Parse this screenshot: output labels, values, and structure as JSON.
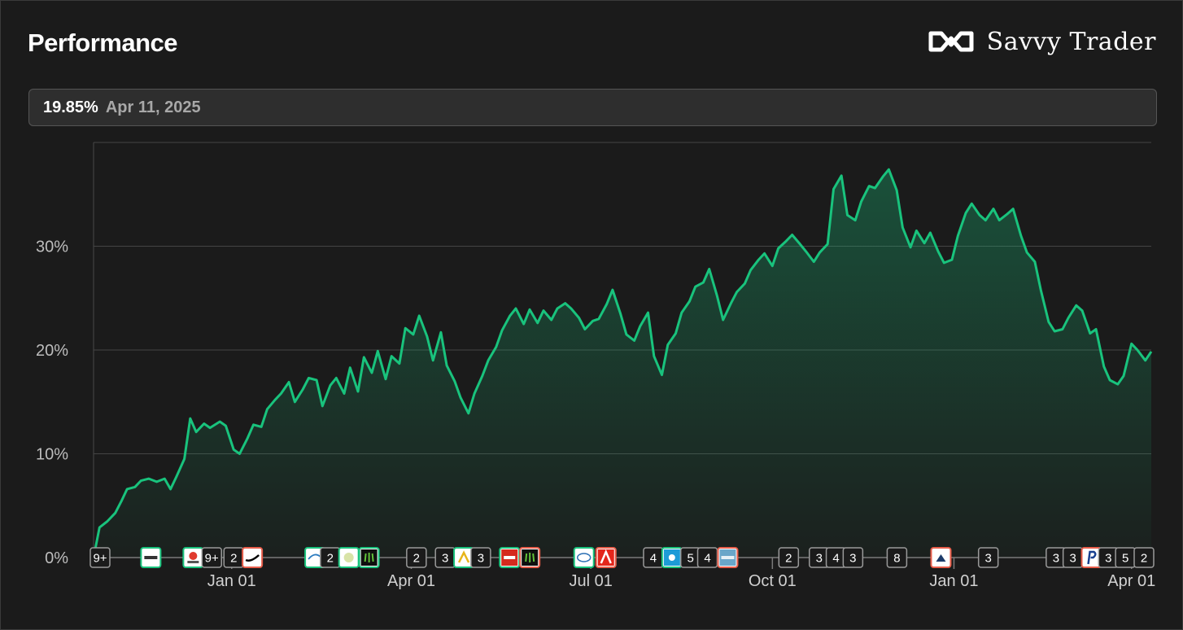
{
  "header": {
    "title": "Performance",
    "brand": "Savvy Trader",
    "brand_icon": "infinity-logo-icon"
  },
  "info": {
    "value": "19.85%",
    "date": "Apr 11, 2025"
  },
  "colors": {
    "line": "#19c37d",
    "background": "#1b1b1b",
    "grid": "#444444",
    "marker_buy": "#19c37d",
    "marker_sell": "#e85d4a"
  },
  "chart_data": {
    "type": "area",
    "title": "",
    "xlabel": "",
    "ylabel": "",
    "ylim": [
      0,
      40
    ],
    "yticks": [
      0,
      10,
      20,
      30
    ],
    "ytick_labels": [
      "0%",
      "10%",
      "20%",
      "30%"
    ],
    "grid": true,
    "xlim": [
      "2023-10-23",
      "2025-04-11"
    ],
    "xticks": [
      {
        "date": "2024-01-01",
        "label": "Jan 01"
      },
      {
        "date": "2024-04-01",
        "label": "Apr 01"
      },
      {
        "date": "2024-07-01",
        "label": "Jul 01"
      },
      {
        "date": "2024-10-01",
        "label": "Oct 01"
      },
      {
        "date": "2025-01-01",
        "label": "Jan 01"
      },
      {
        "date": "2025-04-01",
        "label": "Apr 01"
      }
    ],
    "series": [
      {
        "points": [
          [
            "2023-10-23",
            0.0
          ],
          [
            "2023-10-26",
            2.9
          ],
          [
            "2023-10-30",
            3.5
          ],
          [
            "2023-11-03",
            4.3
          ],
          [
            "2023-11-06",
            5.4
          ],
          [
            "2023-11-09",
            6.6
          ],
          [
            "2023-11-13",
            6.8
          ],
          [
            "2023-11-16",
            7.4
          ],
          [
            "2023-11-20",
            7.6
          ],
          [
            "2023-11-24",
            7.3
          ],
          [
            "2023-11-28",
            7.6
          ],
          [
            "2023-12-01",
            6.6
          ],
          [
            "2023-12-04",
            7.8
          ],
          [
            "2023-12-08",
            9.5
          ],
          [
            "2023-12-11",
            13.4
          ],
          [
            "2023-12-14",
            12.1
          ],
          [
            "2023-12-18",
            12.9
          ],
          [
            "2023-12-21",
            12.5
          ],
          [
            "2023-12-26",
            13.1
          ],
          [
            "2023-12-29",
            12.7
          ],
          [
            "2024-01-02",
            10.4
          ],
          [
            "2024-01-05",
            10.0
          ],
          [
            "2024-01-09",
            11.5
          ],
          [
            "2024-01-12",
            12.8
          ],
          [
            "2024-01-16",
            12.6
          ],
          [
            "2024-01-19",
            14.3
          ],
          [
            "2024-01-23",
            15.2
          ],
          [
            "2024-01-26",
            15.8
          ],
          [
            "2024-01-30",
            16.9
          ],
          [
            "2024-02-02",
            15.0
          ],
          [
            "2024-02-06",
            16.2
          ],
          [
            "2024-02-09",
            17.3
          ],
          [
            "2024-02-13",
            17.1
          ],
          [
            "2024-02-16",
            14.6
          ],
          [
            "2024-02-20",
            16.6
          ],
          [
            "2024-02-23",
            17.3
          ],
          [
            "2024-02-27",
            15.8
          ],
          [
            "2024-03-01",
            18.3
          ],
          [
            "2024-03-05",
            16.0
          ],
          [
            "2024-03-08",
            19.3
          ],
          [
            "2024-03-12",
            17.8
          ],
          [
            "2024-03-15",
            19.9
          ],
          [
            "2024-03-19",
            17.2
          ],
          [
            "2024-03-22",
            19.4
          ],
          [
            "2024-03-26",
            18.7
          ],
          [
            "2024-03-29",
            22.1
          ],
          [
            "2024-04-02",
            21.5
          ],
          [
            "2024-04-05",
            23.3
          ],
          [
            "2024-04-09",
            21.3
          ],
          [
            "2024-04-12",
            19.0
          ],
          [
            "2024-04-16",
            21.7
          ],
          [
            "2024-04-19",
            18.5
          ],
          [
            "2024-04-23",
            17.0
          ],
          [
            "2024-04-26",
            15.4
          ],
          [
            "2024-04-30",
            13.9
          ],
          [
            "2024-05-03",
            15.8
          ],
          [
            "2024-05-07",
            17.5
          ],
          [
            "2024-05-10",
            19.0
          ],
          [
            "2024-05-14",
            20.3
          ],
          [
            "2024-05-17",
            21.9
          ],
          [
            "2024-05-21",
            23.3
          ],
          [
            "2024-05-24",
            24.0
          ],
          [
            "2024-05-28",
            22.5
          ],
          [
            "2024-05-31",
            23.9
          ],
          [
            "2024-06-04",
            22.6
          ],
          [
            "2024-06-07",
            23.8
          ],
          [
            "2024-06-11",
            22.9
          ],
          [
            "2024-06-14",
            24.0
          ],
          [
            "2024-06-18",
            24.5
          ],
          [
            "2024-06-21",
            24.0
          ],
          [
            "2024-06-25",
            23.1
          ],
          [
            "2024-06-28",
            22.0
          ],
          [
            "2024-07-02",
            22.8
          ],
          [
            "2024-07-05",
            23.0
          ],
          [
            "2024-07-09",
            24.4
          ],
          [
            "2024-07-12",
            25.8
          ],
          [
            "2024-07-16",
            23.5
          ],
          [
            "2024-07-19",
            21.5
          ],
          [
            "2024-07-23",
            20.9
          ],
          [
            "2024-07-26",
            22.3
          ],
          [
            "2024-07-30",
            23.6
          ],
          [
            "2024-08-02",
            19.4
          ],
          [
            "2024-08-06",
            17.6
          ],
          [
            "2024-08-09",
            20.5
          ],
          [
            "2024-08-13",
            21.6
          ],
          [
            "2024-08-16",
            23.6
          ],
          [
            "2024-08-20",
            24.7
          ],
          [
            "2024-08-23",
            26.1
          ],
          [
            "2024-08-27",
            26.5
          ],
          [
            "2024-08-30",
            27.8
          ],
          [
            "2024-09-03",
            25.2
          ],
          [
            "2024-09-06",
            22.9
          ],
          [
            "2024-09-10",
            24.5
          ],
          [
            "2024-09-13",
            25.6
          ],
          [
            "2024-09-17",
            26.4
          ],
          [
            "2024-09-20",
            27.7
          ],
          [
            "2024-09-24",
            28.7
          ],
          [
            "2024-09-27",
            29.3
          ],
          [
            "2024-10-01",
            28.1
          ],
          [
            "2024-10-04",
            29.8
          ],
          [
            "2024-10-08",
            30.5
          ],
          [
            "2024-10-11",
            31.1
          ],
          [
            "2024-10-15",
            30.2
          ],
          [
            "2024-10-18",
            29.5
          ],
          [
            "2024-10-22",
            28.5
          ],
          [
            "2024-10-25",
            29.4
          ],
          [
            "2024-10-29",
            30.2
          ],
          [
            "2024-11-01",
            35.5
          ],
          [
            "2024-11-05",
            36.8
          ],
          [
            "2024-11-08",
            33.0
          ],
          [
            "2024-11-12",
            32.5
          ],
          [
            "2024-11-15",
            34.3
          ],
          [
            "2024-11-19",
            35.8
          ],
          [
            "2024-11-22",
            35.6
          ],
          [
            "2024-11-26",
            36.7
          ],
          [
            "2024-11-29",
            37.4
          ],
          [
            "2024-12-03",
            35.4
          ],
          [
            "2024-12-06",
            31.8
          ],
          [
            "2024-12-10",
            29.9
          ],
          [
            "2024-12-13",
            31.5
          ],
          [
            "2024-12-17",
            30.3
          ],
          [
            "2024-12-20",
            31.3
          ],
          [
            "2024-12-24",
            29.5
          ],
          [
            "2024-12-27",
            28.4
          ],
          [
            "2024-12-31",
            28.7
          ],
          [
            "2025-01-03",
            31.0
          ],
          [
            "2025-01-07",
            33.2
          ],
          [
            "2025-01-10",
            34.1
          ],
          [
            "2025-01-14",
            33.0
          ],
          [
            "2025-01-17",
            32.5
          ],
          [
            "2025-01-21",
            33.6
          ],
          [
            "2025-01-24",
            32.5
          ],
          [
            "2025-01-28",
            33.1
          ],
          [
            "2025-01-31",
            33.6
          ],
          [
            "2025-02-04",
            31.0
          ],
          [
            "2025-02-07",
            29.4
          ],
          [
            "2025-02-11",
            28.5
          ],
          [
            "2025-02-14",
            25.8
          ],
          [
            "2025-02-18",
            22.7
          ],
          [
            "2025-02-21",
            21.8
          ],
          [
            "2025-02-25",
            22.0
          ],
          [
            "2025-02-28",
            23.1
          ],
          [
            "2025-03-04",
            24.3
          ],
          [
            "2025-03-07",
            23.8
          ],
          [
            "2025-03-11",
            21.6
          ],
          [
            "2025-03-14",
            22.0
          ],
          [
            "2025-03-18",
            18.4
          ],
          [
            "2025-03-21",
            17.1
          ],
          [
            "2025-03-25",
            16.7
          ],
          [
            "2025-03-28",
            17.5
          ],
          [
            "2025-04-01",
            20.6
          ],
          [
            "2025-04-04",
            20.0
          ],
          [
            "2025-04-08",
            19.0
          ],
          [
            "2025-04-11",
            19.85
          ]
        ]
      }
    ]
  },
  "markers": [
    {
      "date": "2023-10-23",
      "label": "9+",
      "type": "count"
    },
    {
      "date": "2023-11-22",
      "label": "",
      "type": "logo",
      "logo": "ametek-logo-icon",
      "border": "buy"
    },
    {
      "date": "2023-12-17",
      "label": "",
      "type": "logo",
      "logo": "microchip-logo-icon",
      "border": "buy"
    },
    {
      "date": "2023-12-28",
      "label": "9+",
      "type": "count"
    },
    {
      "date": "2024-01-10",
      "label": "2",
      "type": "count"
    },
    {
      "date": "2024-01-21",
      "label": "",
      "type": "logo",
      "logo": "nike-logo-icon",
      "border": "sell"
    },
    {
      "date": "2024-02-27",
      "label": "",
      "type": "logo",
      "logo": "resmed-logo-icon",
      "border": "buy"
    },
    {
      "date": "2024-03-07",
      "label": "2",
      "type": "count"
    },
    {
      "date": "2024-03-18",
      "label": "",
      "type": "logo",
      "logo": "starbucks-logo-icon",
      "border": "buy"
    },
    {
      "date": "2024-03-30",
      "label": "",
      "type": "logo",
      "logo": "monster-logo-icon",
      "border": "buy"
    },
    {
      "date": "2024-04-27",
      "label": "2",
      "type": "count"
    },
    {
      "date": "2024-05-14",
      "label": "3",
      "type": "count"
    },
    {
      "date": "2024-05-25",
      "label": "",
      "type": "logo",
      "logo": "amcor-logo-icon",
      "border": "buy"
    },
    {
      "date": "2024-06-04",
      "label": "3",
      "type": "count"
    },
    {
      "date": "2024-06-21",
      "label": "",
      "type": "logo",
      "logo": "adp-logo-icon",
      "border": "buy"
    },
    {
      "date": "2024-07-03",
      "label": "",
      "type": "logo",
      "logo": "monster-logo-icon",
      "border": "sell"
    },
    {
      "date": "2024-08-04",
      "label": "",
      "type": "logo",
      "logo": "incyte-logo-icon",
      "border": "buy"
    },
    {
      "date": "2024-08-17",
      "label": "",
      "type": "logo",
      "logo": "adobe-logo-icon",
      "border": "sell"
    },
    {
      "date": "2024-09-14",
      "label": "4",
      "type": "count"
    },
    {
      "date": "2024-09-25",
      "label": "",
      "type": "logo",
      "logo": "sun-logo-icon",
      "border": "buy"
    },
    {
      "date": "2024-10-06",
      "label": "5",
      "type": "count"
    },
    {
      "date": "2024-10-16",
      "label": "4",
      "type": "count"
    },
    {
      "date": "2024-10-28",
      "label": "",
      "type": "logo",
      "logo": "globe-logo-icon",
      "border": "sell"
    },
    {
      "date": "2024-12-03",
      "label": "2",
      "type": "count"
    },
    {
      "date": "2024-12-21",
      "label": "3",
      "type": "count"
    },
    {
      "date": "2024-12-31",
      "label": "4",
      "type": "count"
    },
    {
      "date": "2025-01-10",
      "label": "3",
      "type": "count"
    },
    {
      "date": "2025-02-05",
      "label": "8",
      "type": "count"
    },
    {
      "date": "2025-03-03",
      "label": "",
      "type": "logo",
      "logo": "mountain-logo-icon",
      "border": "sell"
    },
    {
      "date": "2025-03-31",
      "label": "3",
      "type": "count"
    },
    {
      "date": "2025-05-10",
      "label": "3",
      "type": "count"
    },
    {
      "date": "2025-05-20",
      "label": "3",
      "type": "count"
    },
    {
      "date": "2025-05-31",
      "label": "",
      "type": "logo",
      "logo": "paypal-logo-icon",
      "border": "sell"
    },
    {
      "date": "2025-06-10",
      "label": "3",
      "type": "count"
    },
    {
      "date": "2025-06-20",
      "label": "5",
      "type": "count"
    },
    {
      "date": "2025-07-01",
      "label": "2",
      "type": "count"
    }
  ]
}
